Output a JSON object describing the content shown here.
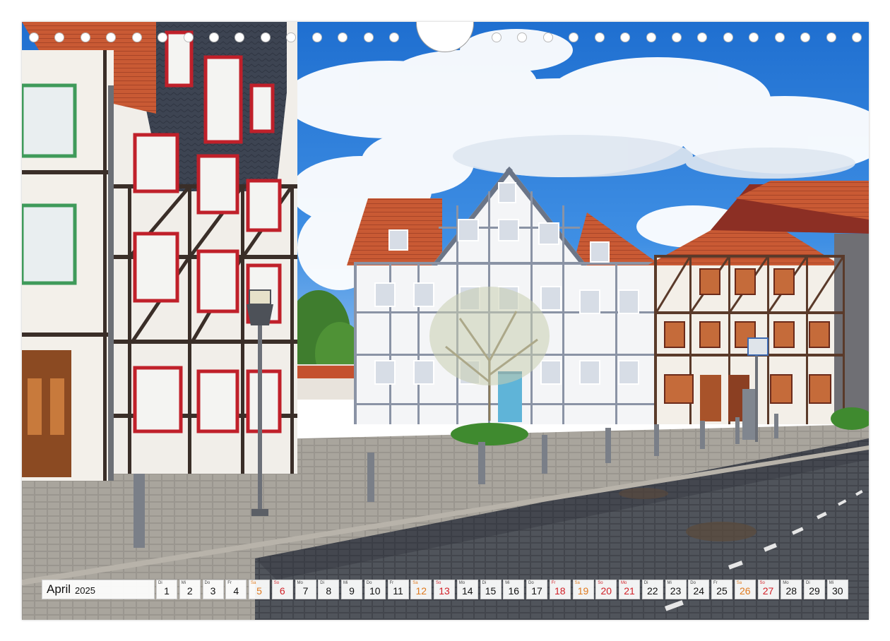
{
  "calendar": {
    "month": "April",
    "year": "2025",
    "days": [
      {
        "wd": "Di",
        "n": "1",
        "kind": "weekday"
      },
      {
        "wd": "Mi",
        "n": "2",
        "kind": "weekday"
      },
      {
        "wd": "Do",
        "n": "3",
        "kind": "weekday"
      },
      {
        "wd": "Fr",
        "n": "4",
        "kind": "weekday"
      },
      {
        "wd": "Sa",
        "n": "5",
        "kind": "sat"
      },
      {
        "wd": "So",
        "n": "6",
        "kind": "sun"
      },
      {
        "wd": "Mo",
        "n": "7",
        "kind": "weekday"
      },
      {
        "wd": "Di",
        "n": "8",
        "kind": "weekday"
      },
      {
        "wd": "Mi",
        "n": "9",
        "kind": "weekday"
      },
      {
        "wd": "Do",
        "n": "10",
        "kind": "weekday"
      },
      {
        "wd": "Fr",
        "n": "11",
        "kind": "weekday"
      },
      {
        "wd": "Sa",
        "n": "12",
        "kind": "sat"
      },
      {
        "wd": "So",
        "n": "13",
        "kind": "sun"
      },
      {
        "wd": "Mo",
        "n": "14",
        "kind": "weekday"
      },
      {
        "wd": "Di",
        "n": "15",
        "kind": "weekday"
      },
      {
        "wd": "Mi",
        "n": "16",
        "kind": "weekday"
      },
      {
        "wd": "Do",
        "n": "17",
        "kind": "weekday"
      },
      {
        "wd": "Fr",
        "n": "18",
        "kind": "hol"
      },
      {
        "wd": "Sa",
        "n": "19",
        "kind": "sat"
      },
      {
        "wd": "So",
        "n": "20",
        "kind": "sun"
      },
      {
        "wd": "Mo",
        "n": "21",
        "kind": "hol"
      },
      {
        "wd": "Di",
        "n": "22",
        "kind": "weekday"
      },
      {
        "wd": "Mi",
        "n": "23",
        "kind": "weekday"
      },
      {
        "wd": "Do",
        "n": "24",
        "kind": "weekday"
      },
      {
        "wd": "Fr",
        "n": "25",
        "kind": "weekday"
      },
      {
        "wd": "Sa",
        "n": "26",
        "kind": "sat"
      },
      {
        "wd": "So",
        "n": "27",
        "kind": "sun"
      },
      {
        "wd": "Mo",
        "n": "28",
        "kind": "weekday"
      },
      {
        "wd": "Di",
        "n": "29",
        "kind": "weekday"
      },
      {
        "wd": "Mi",
        "n": "30",
        "kind": "weekday"
      }
    ]
  },
  "colors": {
    "saturday": "#e07a1e",
    "sunday_holiday": "#d21f26",
    "weekday": "#111111",
    "sky": "#2b7fd8",
    "timber": "#5a3a2a",
    "window_frame_red": "#c0202a"
  },
  "binding": {
    "hole_count_left": 15,
    "hole_count_right": 15
  },
  "icons": {
    "photo": "half-timbered-houses-photo",
    "binding": "spiral-binding-holes",
    "hanger": "calendar-hanger-cutout"
  }
}
